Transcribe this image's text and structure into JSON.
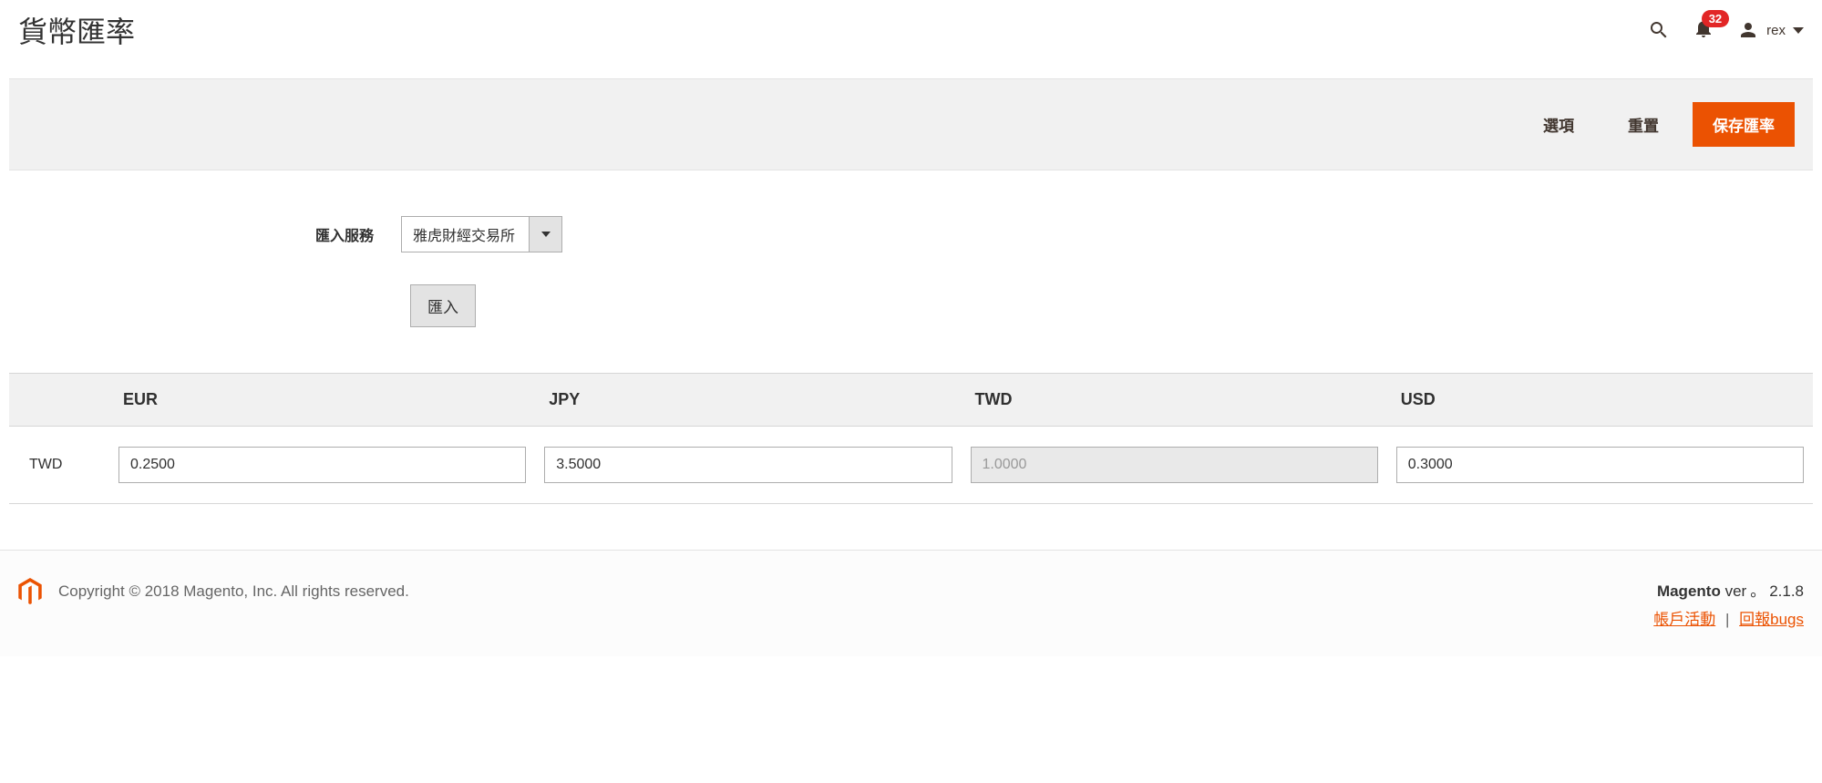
{
  "header": {
    "page_title": "貨幣匯率",
    "notification_count": "32",
    "username": "rex"
  },
  "actions": {
    "options": "選項",
    "reset": "重置",
    "save": "保存匯率"
  },
  "form": {
    "import_service_label": "匯入服務",
    "import_service_value": "雅虎財經交易所",
    "import_button": "匯入"
  },
  "rates": {
    "columns": [
      "",
      "EUR",
      "JPY",
      "TWD",
      "USD"
    ],
    "row_currency": "TWD",
    "values": {
      "EUR": "0.2500",
      "JPY": "3.5000",
      "TWD": "1.0000",
      "USD": "0.3000"
    }
  },
  "footer": {
    "copyright": "Copyright © 2018 Magento, Inc. All rights reserved.",
    "app_name": "Magento",
    "ver_label": "ver",
    "dot": "。",
    "version": "2.1.8",
    "account_activity": "帳戶活動",
    "report_bugs": "回報bugs",
    "separator": "|"
  }
}
